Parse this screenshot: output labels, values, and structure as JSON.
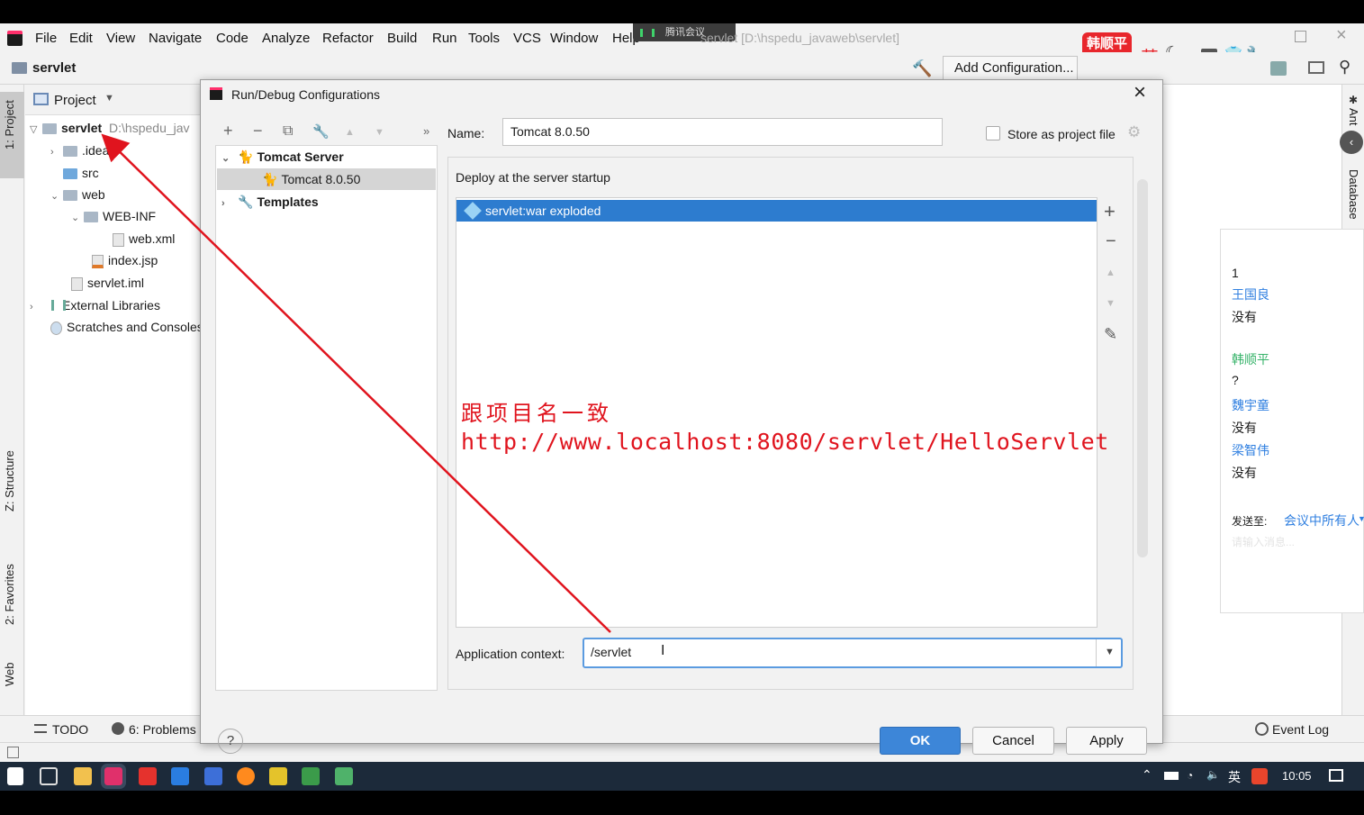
{
  "meeting_tag": "腾讯会议",
  "window_title": "servlet [D:\\hspedu_javaweb\\servlet]",
  "menu": [
    "File",
    "Edit",
    "View",
    "Navigate",
    "Code",
    "Analyze",
    "Refactor",
    "Build",
    "Run",
    "Tools",
    "VCS",
    "Window",
    "Help"
  ],
  "navbar": {
    "project_name": "servlet",
    "add_config_label": "Add Configuration..."
  },
  "brand_badge": "韩顺平教育",
  "ime_indicator": "英",
  "left_tabs": {
    "project": "1: Project",
    "structure": "Z: Structure",
    "favorites": "2: Favorites",
    "web": "Web"
  },
  "right_tabs": {
    "ant": "Ant",
    "database": "Database"
  },
  "project_panel": {
    "header": "Project",
    "tree": [
      {
        "label": "servlet",
        "hint": "D:\\hspedu_jav"
      },
      {
        "label": ".idea"
      },
      {
        "label": "src"
      },
      {
        "label": "web"
      },
      {
        "label": "WEB-INF"
      },
      {
        "label": "web.xml"
      },
      {
        "label": "index.jsp"
      },
      {
        "label": "servlet.iml"
      },
      {
        "label": "External Libraries"
      },
      {
        "label": "Scratches and Consoles"
      }
    ]
  },
  "dialog": {
    "title": "Run/Debug Configurations",
    "name_label": "Name:",
    "name_value": "Tomcat 8.0.50",
    "store_label": "Store as project file",
    "tree": {
      "group": "Tomcat Server",
      "item": "Tomcat 8.0.50",
      "templates": "Templates"
    },
    "deploy_label": "Deploy at the server startup",
    "deploy_items": [
      "servlet:war exploded"
    ],
    "app_context_label": "Application context:",
    "app_context_value": "/servlet",
    "buttons": {
      "ok": "OK",
      "cancel": "Cancel",
      "apply": "Apply"
    },
    "help": "?"
  },
  "annotation": {
    "line1": "跟项目名一致",
    "line2": "http://www.localhost:8080/servlet/HelloServlet",
    "color": "#e0141e"
  },
  "bottom_tabs": {
    "todo": "TODO",
    "problems": "6: Problems",
    "event_log": "Event Log"
  },
  "chat": {
    "messages": [
      "1",
      "王国良",
      "没有",
      "韩顺平",
      "?",
      "魏宇童",
      "没有",
      "梁智伟",
      "没有"
    ],
    "send_label": "发送至:",
    "send_target": "会议中所有人",
    "input_placeholder": "请输入消息..."
  },
  "taskbar": {
    "ime": "英",
    "time": "10:05"
  }
}
